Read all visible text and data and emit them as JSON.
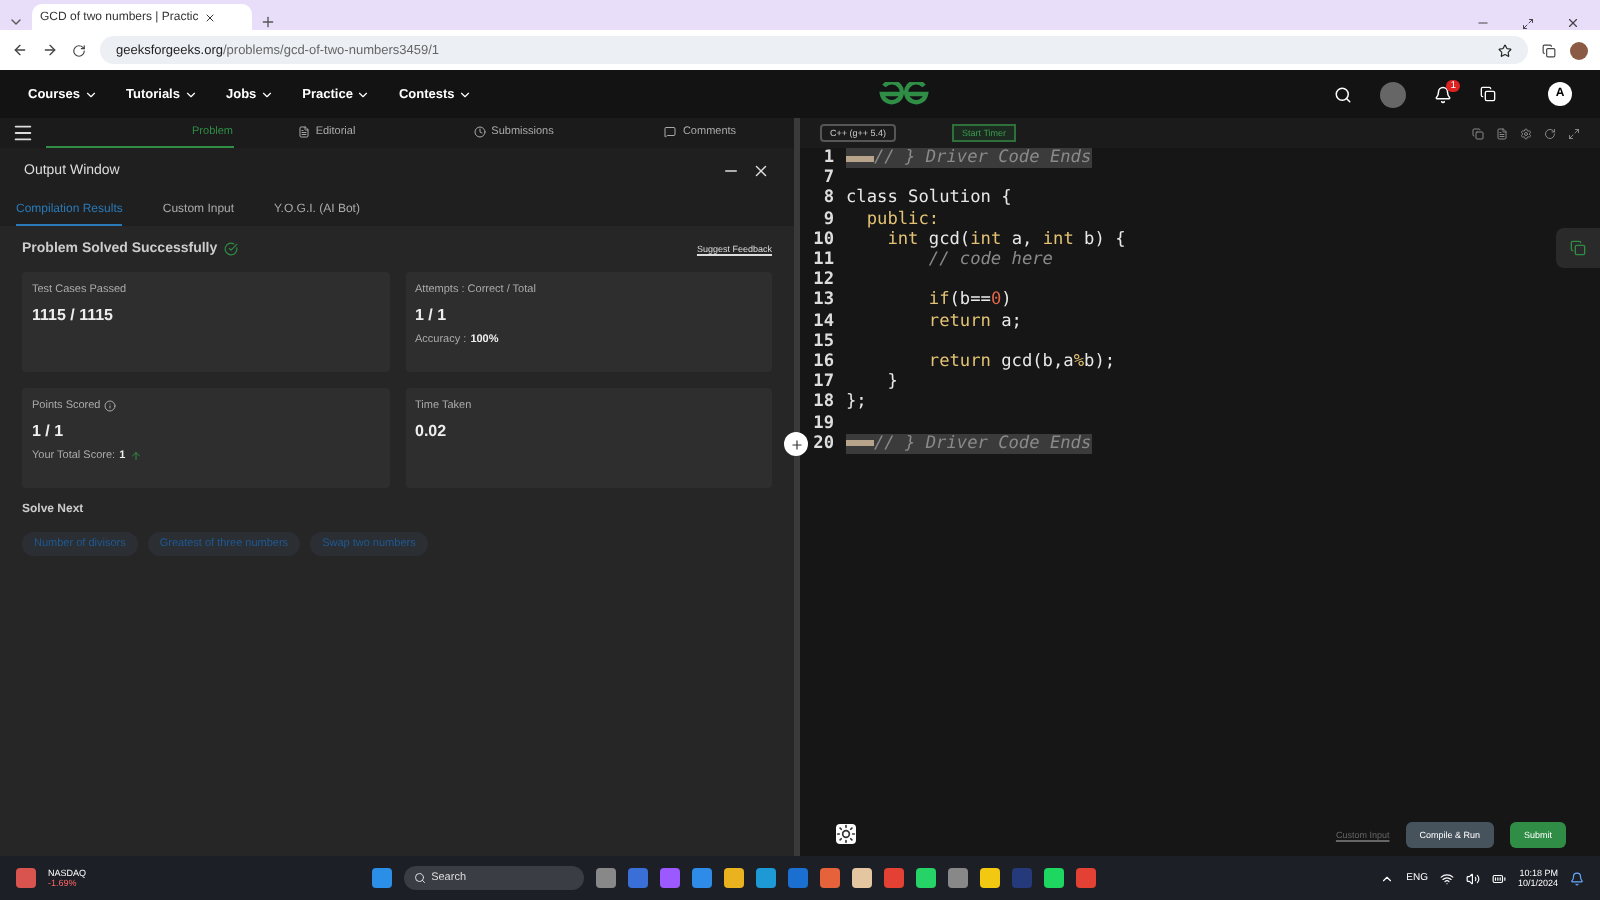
{
  "browser": {
    "tab_title": "GCD of two numbers | Practic",
    "url_host": "geeksforgeeks.org",
    "url_path": "/problems/gcd-of-two-numbers3459/1"
  },
  "site_nav": {
    "menus": [
      "Courses",
      "Tutorials",
      "Jobs",
      "Practice",
      "Contests"
    ],
    "notification_count": "1",
    "avatar": "A"
  },
  "subtabs": [
    {
      "label": "Problem",
      "selected": true
    },
    {
      "label": "Editorial",
      "selected": false
    },
    {
      "label": "Submissions",
      "selected": false
    },
    {
      "label": "Comments",
      "selected": false
    }
  ],
  "output_window": {
    "title": "Output Window",
    "tabs": [
      {
        "label": "Compilation Results",
        "selected": true
      },
      {
        "label": "Custom Input",
        "selected": false
      },
      {
        "label": "Y.O.G.I. (AI Bot)",
        "selected": false
      }
    ],
    "status": "Problem Solved Successfully",
    "feedback_link": "Suggest Feedback",
    "cards": [
      {
        "label": "Test Cases Passed",
        "value": "1115 / 1115"
      },
      {
        "label": "Attempts : Correct / Total",
        "value": "1 / 1",
        "note_label": "Accuracy :",
        "note_value": "100%"
      },
      {
        "label": "Points Scored",
        "value": "1 / 1",
        "note_label": "Your Total Score:",
        "note_value": "1",
        "info": true,
        "trend": true
      },
      {
        "label": "Time Taken",
        "value": "0.02"
      }
    ],
    "solve_next_title": "Solve Next",
    "solve_next": [
      "Number of divisors",
      "Greatest of three numbers",
      "Swap two numbers"
    ]
  },
  "editor": {
    "language": "C++ (g++ 5.4)",
    "timer": "Start Timer",
    "custom_input": "Custom Input",
    "compile": "Compile & Run",
    "submit": "Submit",
    "lines": [
      {
        "number": "1",
        "folded": true,
        "tokens": [
          {
            "text": "// } Driver Code Ends",
            "kind": "comment"
          }
        ]
      },
      {
        "number": "7",
        "folded": false
      },
      {
        "number": "8",
        "folded": false,
        "tokens": [
          {
            "text": "class Solution {",
            "kind": "plain"
          }
        ]
      },
      {
        "number": "9",
        "folded": false,
        "tokens": [
          {
            "text": "  public:",
            "kind": "keyword"
          }
        ]
      },
      {
        "number": "10",
        "folded": false,
        "tokens": [
          {
            "text": "    int ",
            "kind": "keyword"
          },
          {
            "text": "gcd(",
            "kind": "plain"
          },
          {
            "text": "int ",
            "kind": "keyword"
          },
          {
            "text": "a, ",
            "kind": "plain"
          },
          {
            "text": "int ",
            "kind": "keyword"
          },
          {
            "text": "b) {",
            "kind": "plain"
          }
        ]
      },
      {
        "number": "11",
        "folded": false,
        "tokens": [
          {
            "text": "        // code here",
            "kind": "comment"
          }
        ]
      },
      {
        "number": "12",
        "folded": false
      },
      {
        "number": "13",
        "folded": false,
        "tokens": [
          {
            "text": "        if",
            "kind": "keyword"
          },
          {
            "text": "(b==",
            "kind": "plain"
          },
          {
            "text": "0",
            "kind": "number"
          },
          {
            "text": ")",
            "kind": "plain"
          }
        ]
      },
      {
        "number": "14",
        "folded": false,
        "tokens": [
          {
            "text": "        return ",
            "kind": "keyword"
          },
          {
            "text": "a;",
            "kind": "plain"
          }
        ]
      },
      {
        "number": "15",
        "folded": false
      },
      {
        "number": "16",
        "folded": false,
        "tokens": [
          {
            "text": "        return ",
            "kind": "keyword"
          },
          {
            "text": "gcd(b,a",
            "kind": "plain"
          },
          {
            "text": "%",
            "kind": "keyword"
          },
          {
            "text": "b);",
            "kind": "plain"
          }
        ]
      },
      {
        "number": "17",
        "folded": false,
        "tokens": [
          {
            "text": "    }",
            "kind": "plain"
          }
        ]
      },
      {
        "number": "18",
        "folded": false,
        "tokens": [
          {
            "text": "};",
            "kind": "plain"
          }
        ]
      },
      {
        "number": "19",
        "folded": false
      },
      {
        "number": "20",
        "folded": true,
        "tokens": [
          {
            "text": "// } Driver Code Ends",
            "kind": "comment"
          }
        ]
      }
    ]
  },
  "taskbar": {
    "stock_name": "NASDAQ",
    "stock_change": "-1.69%",
    "search": "Search",
    "language": "ENG",
    "time": "10:18 PM",
    "date": "10/1/2024"
  }
}
